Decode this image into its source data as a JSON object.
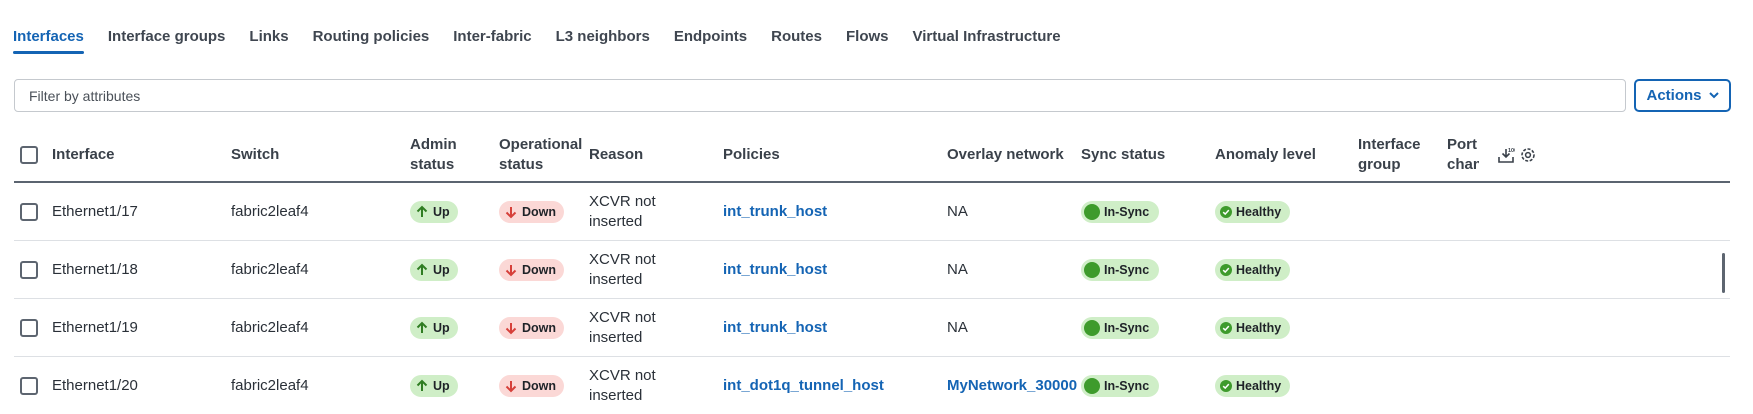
{
  "tabs": [
    {
      "label": "Interfaces",
      "active": true
    },
    {
      "label": "Interface groups"
    },
    {
      "label": "Links"
    },
    {
      "label": "Routing policies"
    },
    {
      "label": "Inter-fabric"
    },
    {
      "label": "L3 neighbors"
    },
    {
      "label": "Endpoints"
    },
    {
      "label": "Routes"
    },
    {
      "label": "Flows"
    },
    {
      "label": "Virtual Infrastructure"
    }
  ],
  "filter": {
    "placeholder": "Filter by attributes"
  },
  "actions": {
    "label": "Actions"
  },
  "columns": {
    "interface": "Interface",
    "switch": "Switch",
    "admin_status_1": "Admin",
    "admin_status_2": "status",
    "operational_status_1": "Operational",
    "operational_status_2": "status",
    "reason": "Reason",
    "policies": "Policies",
    "overlay_network": "Overlay network",
    "sync_status": "Sync status",
    "anomaly_level": "Anomaly level",
    "interface_group_1": "Interface",
    "interface_group_2": "group",
    "port_channel_1": "Port",
    "port_channel_2": "chan"
  },
  "rows": [
    {
      "interface": "Ethernet1/17",
      "switch": "fabric2leaf4",
      "admin": "Up",
      "oper": "Down",
      "reason_1": "XCVR not",
      "reason_2": "inserted",
      "policy": "int_trunk_host",
      "overlay": "NA",
      "overlay_link": false,
      "sync": "In-Sync",
      "anomaly": "Healthy"
    },
    {
      "interface": "Ethernet1/18",
      "switch": "fabric2leaf4",
      "admin": "Up",
      "oper": "Down",
      "reason_1": "XCVR not",
      "reason_2": "inserted",
      "policy": "int_trunk_host",
      "overlay": "NA",
      "overlay_link": false,
      "sync": "In-Sync",
      "anomaly": "Healthy"
    },
    {
      "interface": "Ethernet1/19",
      "switch": "fabric2leaf4",
      "admin": "Up",
      "oper": "Down",
      "reason_1": "XCVR not",
      "reason_2": "inserted",
      "policy": "int_trunk_host",
      "overlay": "NA",
      "overlay_link": false,
      "sync": "In-Sync",
      "anomaly": "Healthy"
    },
    {
      "interface": "Ethernet1/20",
      "switch": "fabric2leaf4",
      "admin": "Up",
      "oper": "Down",
      "reason_1": "XCVR not",
      "reason_2": "inserted",
      "policy": "int_dot1q_tunnel_host",
      "overlay": "MyNetwork_30000",
      "overlay_link": true,
      "sync": "In-Sync",
      "anomaly": "Healthy"
    }
  ],
  "colors": {
    "accent": "#1464b4",
    "success": "#3e9b2c",
    "danger": "#d6403a"
  }
}
